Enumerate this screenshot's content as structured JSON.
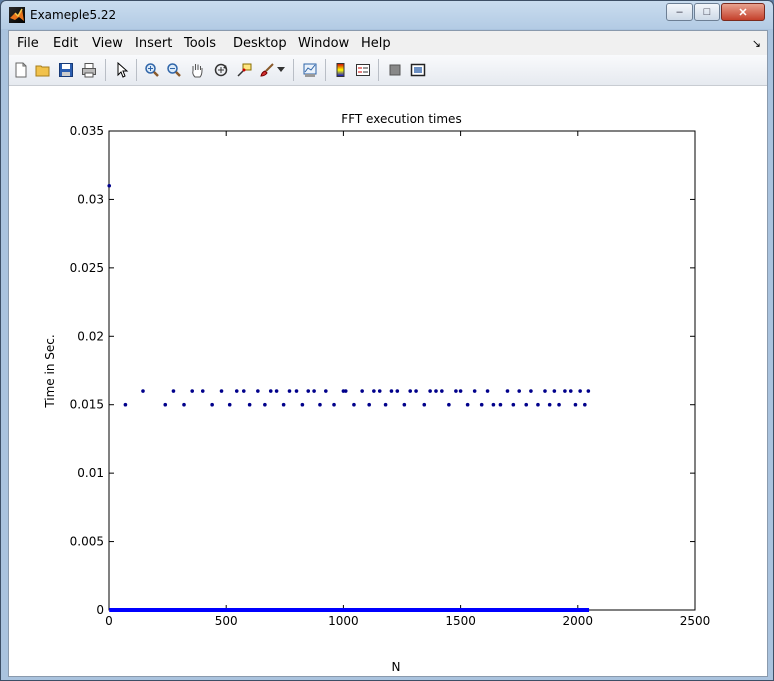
{
  "window": {
    "title": "Exameple5.22",
    "min_label": "‒",
    "max_label": "□",
    "close_label": "✕"
  },
  "menu": {
    "items": [
      "File",
      "Edit",
      "View",
      "Insert",
      "Tools",
      "Desktop",
      "Window",
      "Help"
    ],
    "dock_glyph": "↘"
  },
  "toolbar": {
    "icons": [
      "new-figure-icon",
      "open-file-icon",
      "save-icon",
      "print-icon",
      "edit-plot-arrow-icon",
      "zoom-in-icon",
      "zoom-out-icon",
      "pan-hand-icon",
      "rotate-3d-icon",
      "data-cursor-icon",
      "brush-icon",
      "brush-dropdown-icon",
      "link-plot-icon",
      "colorbar-icon",
      "legend-icon",
      "hide-plot-tools-icon",
      "show-plot-tools-icon"
    ]
  },
  "colors": {
    "marker": "#00008b",
    "baseline": "#0000ff"
  },
  "chart_data": {
    "type": "scatter",
    "title": "FFT execution times",
    "xlabel": "N",
    "ylabel": "Time in Sec.",
    "xlim": [
      0,
      2500
    ],
    "ylim": [
      0,
      0.035
    ],
    "xticks": [
      0,
      500,
      1000,
      1500,
      2000,
      2500
    ],
    "yticks": [
      0,
      0.005,
      0.01,
      0.015,
      0.02,
      0.025,
      0.03,
      0.035
    ],
    "ytick_labels": [
      "0",
      "0.005",
      "0.01",
      "0.015",
      "0.02",
      "0.025",
      "0.03",
      "0.035"
    ],
    "grid": false,
    "legend": "none",
    "series": [
      {
        "marker": "dot",
        "points": [
          [
            1,
            0.031
          ],
          [
            70,
            0.015
          ],
          [
            145,
            0.016
          ],
          [
            240,
            0.015
          ],
          [
            275,
            0.016
          ],
          [
            320,
            0.015
          ],
          [
            355,
            0.016
          ],
          [
            400,
            0.016
          ],
          [
            440,
            0.015
          ],
          [
            480,
            0.016
          ],
          [
            515,
            0.015
          ],
          [
            545,
            0.016
          ],
          [
            575,
            0.016
          ],
          [
            600,
            0.015
          ],
          [
            635,
            0.016
          ],
          [
            665,
            0.015
          ],
          [
            690,
            0.016
          ],
          [
            715,
            0.016
          ],
          [
            745,
            0.015
          ],
          [
            770,
            0.016
          ],
          [
            800,
            0.016
          ],
          [
            825,
            0.015
          ],
          [
            850,
            0.016
          ],
          [
            875,
            0.016
          ],
          [
            900,
            0.015
          ],
          [
            925,
            0.016
          ],
          [
            960,
            0.015
          ],
          [
            1000,
            0.016
          ],
          [
            1010,
            0.016
          ],
          [
            1045,
            0.015
          ],
          [
            1080,
            0.016
          ],
          [
            1110,
            0.015
          ],
          [
            1130,
            0.016
          ],
          [
            1155,
            0.016
          ],
          [
            1180,
            0.015
          ],
          [
            1205,
            0.016
          ],
          [
            1230,
            0.016
          ],
          [
            1260,
            0.015
          ],
          [
            1285,
            0.016
          ],
          [
            1310,
            0.016
          ],
          [
            1345,
            0.015
          ],
          [
            1370,
            0.016
          ],
          [
            1395,
            0.016
          ],
          [
            1420,
            0.016
          ],
          [
            1450,
            0.015
          ],
          [
            1480,
            0.016
          ],
          [
            1500,
            0.016
          ],
          [
            1530,
            0.015
          ],
          [
            1560,
            0.016
          ],
          [
            1590,
            0.015
          ],
          [
            1615,
            0.016
          ],
          [
            1640,
            0.015
          ],
          [
            1670,
            0.015
          ],
          [
            1700,
            0.016
          ],
          [
            1725,
            0.015
          ],
          [
            1750,
            0.016
          ],
          [
            1780,
            0.015
          ],
          [
            1800,
            0.016
          ],
          [
            1830,
            0.015
          ],
          [
            1860,
            0.016
          ],
          [
            1880,
            0.015
          ],
          [
            1900,
            0.016
          ],
          [
            1920,
            0.015
          ],
          [
            1945,
            0.016
          ],
          [
            1970,
            0.016
          ],
          [
            1990,
            0.015
          ],
          [
            2010,
            0.016
          ],
          [
            2030,
            0.015
          ],
          [
            2045,
            0.016
          ]
        ],
        "baseline": {
          "x_from": 1,
          "x_to": 2048,
          "y": 0
        }
      }
    ]
  }
}
